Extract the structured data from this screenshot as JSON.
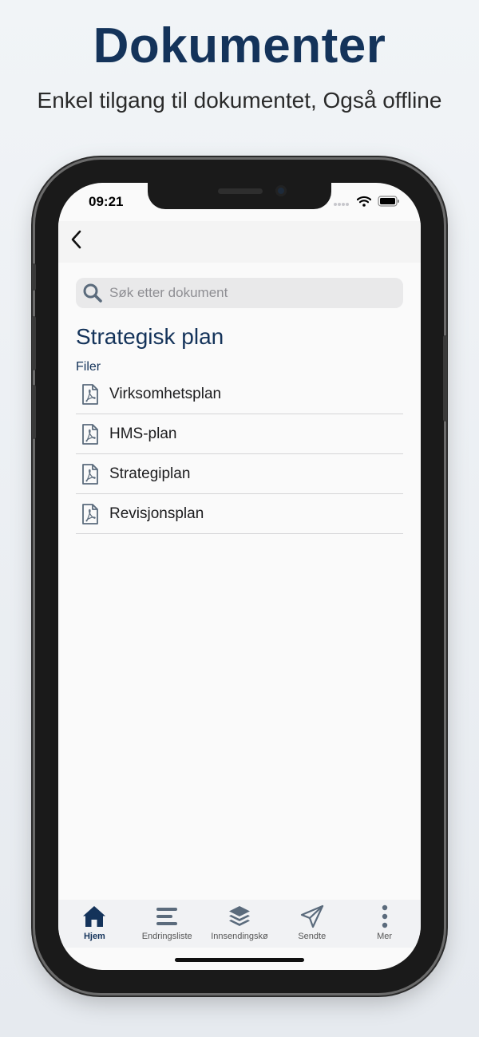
{
  "promo": {
    "title": "Dokumenter",
    "subtitle": "Enkel tilgang til dokumentet, Også offline"
  },
  "status_bar": {
    "time": "09:21",
    "icons": [
      "signal-dots-icon",
      "wifi-icon",
      "battery-icon"
    ]
  },
  "nav": {
    "back_icon": "chevron-left-icon"
  },
  "search": {
    "placeholder": "Søk etter dokument",
    "value": ""
  },
  "folder": {
    "title": "Strategisk plan",
    "section_label": "Filer",
    "files": [
      {
        "name": "Virksomhetsplan",
        "icon": "pdf-file-icon"
      },
      {
        "name": "HMS-plan",
        "icon": "pdf-file-icon"
      },
      {
        "name": "Strategiplan",
        "icon": "pdf-file-icon"
      },
      {
        "name": "Revisjonsplan",
        "icon": "pdf-file-icon"
      }
    ]
  },
  "tab_bar": {
    "tabs": [
      {
        "label": "Hjem",
        "icon": "home-icon",
        "active": true
      },
      {
        "label": "Endringsliste",
        "icon": "list-icon",
        "active": false
      },
      {
        "label": "Innsendingskø",
        "icon": "layers-icon",
        "active": false
      },
      {
        "label": "Sendte",
        "icon": "paper-plane-icon",
        "active": false
      },
      {
        "label": "Mer",
        "icon": "more-vertical-icon",
        "active": false
      }
    ]
  },
  "colors": {
    "brand_navy": "#14335a",
    "icon_slate": "#5b6b7c",
    "tab_active": "#14335a",
    "tab_inactive": "#5b6b7c"
  }
}
